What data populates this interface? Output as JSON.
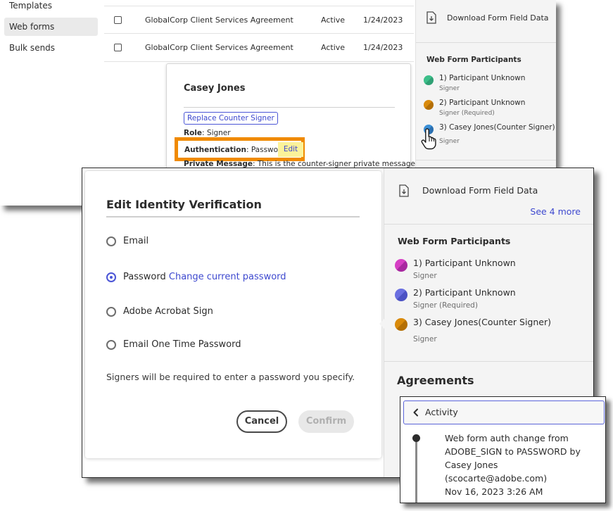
{
  "top_screenshot": {
    "nav": {
      "items": [
        {
          "label": "Templates",
          "selected": false
        },
        {
          "label": "Web forms",
          "selected": true
        },
        {
          "label": "Bulk sends",
          "selected": false
        }
      ]
    },
    "table": {
      "rows": [
        {
          "name": "GlobalCorp Client Services Agreement",
          "status": "Active",
          "date": "1/24/2023"
        },
        {
          "name": "GlobalCorp Client Services Agreement",
          "status": "Active",
          "date": "1/24/2023"
        }
      ]
    },
    "popover": {
      "name": "Casey Jones",
      "replace_button": "Replace Counter Signer",
      "role_label": "Role",
      "role_value": ": Signer",
      "auth_label": "Authentication",
      "auth_value": ": Password",
      "edit_label": "Edit",
      "message_label": "Private Message",
      "message_value": ": This is the counter-signer private message",
      "highlight_color": "#f08a00"
    },
    "side_panel": {
      "download_label": "Download Form Field Data",
      "participants_title": "Web Form Participants",
      "participants": [
        {
          "name": "1) Participant Unknown",
          "role": "Signer",
          "color": "#3dbf8a"
        },
        {
          "name": "2) Participant Unknown",
          "role": "Signer (Required)",
          "color": "#d98a0b"
        },
        {
          "name": "3) Casey Jones(Counter Signer)",
          "role": "Signer",
          "color": "#3b8fd6"
        }
      ]
    }
  },
  "modal": {
    "title": "Edit Identity Verification",
    "options": [
      {
        "label": "Email",
        "checked": false,
        "link": ""
      },
      {
        "label": "Password",
        "checked": true,
        "link": "Change current password"
      },
      {
        "label": "Adobe Acrobat Sign",
        "checked": false,
        "link": ""
      },
      {
        "label": "Email One Time Password",
        "checked": false,
        "link": ""
      }
    ],
    "help_text": "Signers will be required to enter a password you specify.",
    "cancel_label": "Cancel",
    "confirm_label": "Confirm",
    "accent_color": "#4b55d6"
  },
  "side_panel": {
    "download_label": "Download Form Field Data",
    "see_more_label": "See 4 more",
    "participants_title": "Web Form Participants",
    "participants": [
      {
        "name": "1) Participant Unknown",
        "role": "Signer",
        "color": "#d63fc4"
      },
      {
        "name": "2) Participant Unknown",
        "role": "Signer (Required)",
        "color": "#6a6fe0"
      },
      {
        "name": "3) Casey Jones(Counter Signer)",
        "role": "Signer",
        "color": "#d98a0b"
      }
    ],
    "agreements_title": "Agreements"
  },
  "activity": {
    "header": "Activity",
    "event_lines": [
      "Web form auth change from",
      "ADOBE_SIGN to PASSWORD by",
      "Casey Jones",
      "(scocarte@adobe.com)",
      "Nov 16, 2023 3:26 AM"
    ]
  }
}
